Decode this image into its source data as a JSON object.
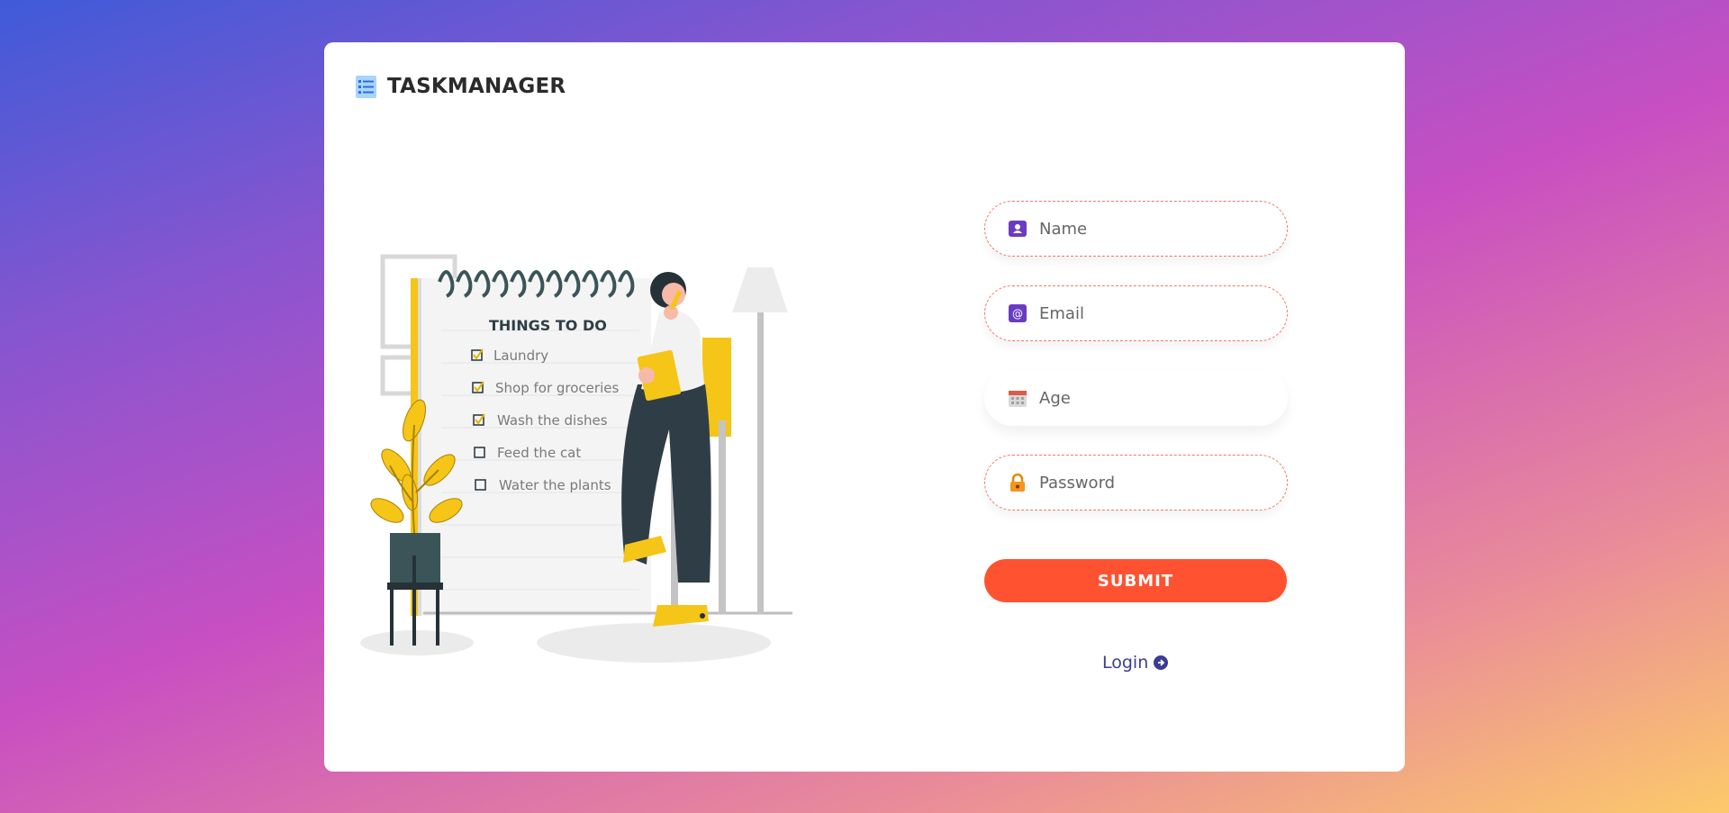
{
  "brand": {
    "title": "TASKMANAGER",
    "icon": "list-icon"
  },
  "illustration": {
    "heading": "THINGS TO DO",
    "items": [
      {
        "label": "Laundry",
        "checked": true
      },
      {
        "label": "Shop for groceries",
        "checked": true
      },
      {
        "label": "Wash the dishes",
        "checked": true
      },
      {
        "label": "Feed the cat",
        "checked": false
      },
      {
        "label": "Water the plants",
        "checked": false
      }
    ]
  },
  "form": {
    "name_placeholder": "Name",
    "email_placeholder": "Email",
    "age_placeholder": "Age",
    "password_placeholder": "Password",
    "submit_label": "SUBMIT",
    "login_label": "Login"
  },
  "colors": {
    "accent": "#ff5231",
    "link": "#3b3c95",
    "field_border": "#f0786a",
    "brand_icon_bg": "#a8d4ff"
  }
}
